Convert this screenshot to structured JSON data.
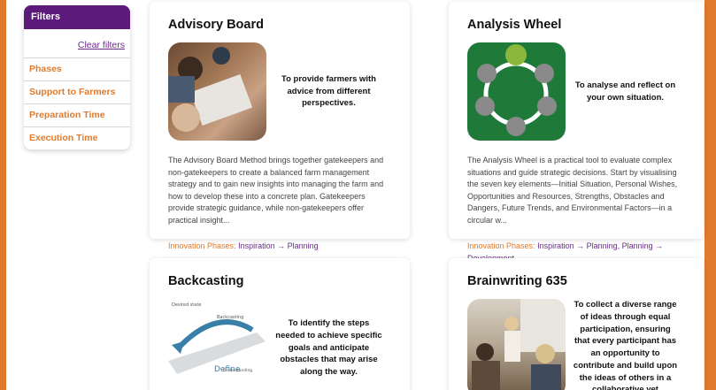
{
  "filters": {
    "title": "Filters",
    "clear_label": "Clear filters",
    "items": [
      "Phases",
      "Support to Farmers",
      "Preparation Time",
      "Execution Time"
    ]
  },
  "cards": [
    {
      "title": "Advisory Board",
      "summary": "To provide farmers with advice from different perspectives.",
      "description": "The Advisory Board Method brings together gatekeepers and non-gatekeepers to create a balanced farm management strategy and to gain new insights into managing the farm and how to develop these into a concrete plan. Gatekeepers provide strategic guidance, while non-gatekeepers offer practical insight...",
      "phases_label": "Innovation Phases:",
      "phases_value": "Inspiration → Planning"
    },
    {
      "title": "Analysis Wheel",
      "summary": "To analyse and reflect on your own situation.",
      "description": "The Analysis Wheel is a practical tool to evaluate complex situations and guide strategic decisions. Start by visualising the seven key elements—Initial Situation, Personal Wishes, Opportunities and Resources, Strengths, Obstacles and Dangers, Future Trends, and Environmental Factors—in a circular w...",
      "phases_label": "Innovation Phases:",
      "phases_value": "Inspiration → Planning, Planning → Development"
    },
    {
      "title": "Backcasting",
      "summary": "To identify the steps needed to achieve specific goals and anticipate obstacles that may arise along the way.",
      "image_labels": [
        "Desired state",
        "Backcasting",
        "Define",
        "Understanding"
      ]
    },
    {
      "title": "Brainwriting 635",
      "summary": "To collect a diverse range of ideas through equal participation, ensuring that every participant has an opportunity to contribute and build upon the ideas of others in a collaborative yet structured manner"
    }
  ]
}
